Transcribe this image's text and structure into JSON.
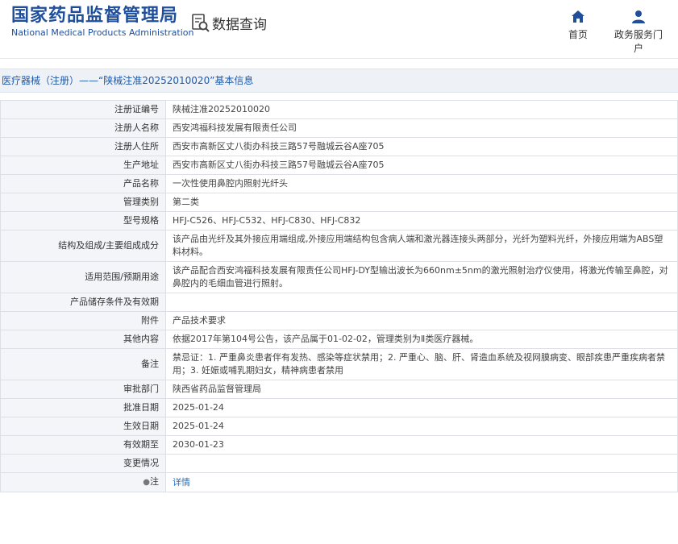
{
  "header": {
    "logo_cn": "国家药品监督管理局",
    "logo_en": "National Medical Products Administration",
    "query_label": "数据查询",
    "nav": {
      "home": "首页",
      "portal": "政务服务门户"
    }
  },
  "title": "医疗器械（注册）——“陕械注准20252010020”基本信息",
  "rows": [
    {
      "label": "注册证编号",
      "value": "陕械注准20252010020"
    },
    {
      "label": "注册人名称",
      "value": "西安鸿福科技发展有限责任公司"
    },
    {
      "label": "注册人住所",
      "value": "西安市高新区丈八街办科技三路57号融城云谷A座705"
    },
    {
      "label": "生产地址",
      "value": "西安市高新区丈八街办科技三路57号融城云谷A座705"
    },
    {
      "label": "产品名称",
      "value": "一次性使用鼻腔内照射光纤头"
    },
    {
      "label": "管理类别",
      "value": "第二类"
    },
    {
      "label": "型号规格",
      "value": "HFJ-C526、HFJ-C532、HFJ-C830、HFJ-C832"
    },
    {
      "label": "结构及组成/主要组成成分",
      "value": "该产品由光纤及其外接应用端组成,外接应用端结构包含病人端和激光器连接头两部分，光纤为塑料光纤，外接应用端为ABS塑料材料。"
    },
    {
      "label": "适用范围/预期用途",
      "value": "该产品配合西安鸿福科技发展有限责任公司HFJ-DY型输出波长为660nm±5nm的激光照射治疗仪使用，将激光传输至鼻腔，对鼻腔内的毛细血管进行照射。"
    },
    {
      "label": "产品储存条件及有效期",
      "value": ""
    },
    {
      "label": "附件",
      "value": "产品技术要求"
    },
    {
      "label": "其他内容",
      "value": "依据2017年第104号公告，该产品属于01-02-02，管理类别为Ⅱ类医疗器械。"
    },
    {
      "label": "备注",
      "value": "禁忌证：1. 严重鼻炎患者伴有发热、感染等症状禁用；2. 严重心、脑、肝、肾造血系统及视网膜病变、眼部疾患严重疾病者禁用；3. 妊娠或哺乳期妇女，精神病患者禁用"
    },
    {
      "label": "审批部门",
      "value": "陕西省药品监督管理局"
    },
    {
      "label": "批准日期",
      "value": "2025-01-24"
    },
    {
      "label": "生效日期",
      "value": "2025-01-24"
    },
    {
      "label": "有效期至",
      "value": "2030-01-23"
    },
    {
      "label": "变更情况",
      "value": ""
    }
  ],
  "note": {
    "label": "注",
    "link": "详情"
  },
  "colors": {
    "brand": "#1f4e9b",
    "link": "#1e6fc0",
    "label_bg": "#f3f5f9"
  }
}
